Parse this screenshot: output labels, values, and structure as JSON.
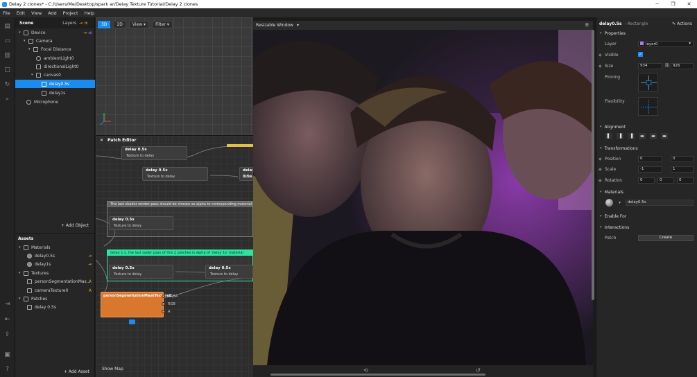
{
  "window": {
    "title": "Delay 2 clones* - C:/Users/Me/Desktop/spark ar/Delay Texture Tutorial/Delay 2 clones",
    "controls": [
      "─",
      "❐",
      "✕"
    ]
  },
  "menu": [
    "File",
    "Edit",
    "View",
    "Add",
    "Project",
    "Help"
  ],
  "scene_panel": {
    "tabs": [
      "Scene",
      "Layers"
    ],
    "items": [
      {
        "label": "Device",
        "icon": "device-icon"
      },
      {
        "label": "Camera",
        "icon": "camera-icon"
      },
      {
        "label": "Focal Distance",
        "icon": "focal-distance-icon"
      },
      {
        "label": "ambientLight0",
        "icon": "ambient-light-icon"
      },
      {
        "label": "directionalLight0",
        "icon": "directional-light-icon"
      },
      {
        "label": "canvas0",
        "icon": "canvas-icon"
      },
      {
        "label": "delay0.5s",
        "icon": "rectangle-icon",
        "selected": true
      },
      {
        "label": "delay1s",
        "icon": "rectangle-icon"
      },
      {
        "label": "Microphone",
        "icon": "microphone-icon"
      }
    ],
    "add_object": "+ Add Object"
  },
  "assets_panel": {
    "title": "Assets",
    "items": [
      {
        "label": "Materials",
        "icon": "folder-icon"
      },
      {
        "label": "delay0.5s",
        "icon": "material-icon"
      },
      {
        "label": "delay1s",
        "icon": "material-icon"
      },
      {
        "label": "Textures",
        "icon": "folder-icon"
      },
      {
        "label": "personSegmentationMas...",
        "icon": "texture-icon",
        "badge": "A"
      },
      {
        "label": "cameraTexture0",
        "icon": "texture-icon",
        "badge": "A"
      },
      {
        "label": "Patches",
        "icon": "folder-icon"
      },
      {
        "label": "delay 0.5s",
        "icon": "patch-icon"
      }
    ],
    "add_asset": "+ Add Asset"
  },
  "viewport_toolbar": {
    "mode_3d": "3D",
    "mode_2d": "2D",
    "view": "View",
    "filter": "Filter"
  },
  "patch_editor": {
    "title": "Patch Editor",
    "group1_label": "The last shader render pass should be chosen as alpha to corresponding material",
    "group2_label": "delay 1 s, the last sader pass of this 2 patches is alpha of 'delay 1s' material",
    "node_title": "delay 0.5s",
    "node_port": "Texture to delay",
    "camera_node": "personSegmentationMaskTexture0",
    "ports": [
      "RGBA",
      "RGB",
      "A"
    ],
    "show_map": "Show Map"
  },
  "preview": {
    "header": "Resizable Window"
  },
  "properties": {
    "object_name": "delay0.5s",
    "object_type": "- Rectangle",
    "actions": "Actions",
    "sections": {
      "properties": "Properties",
      "alignment": "Alignment",
      "transformations": "Transformations",
      "materials": "Materials",
      "enable_for": "Enable For",
      "interactions": "Interactions"
    },
    "layer_label": "Layer",
    "layer_value": "layer0",
    "visible_label": "Visible",
    "size_label": "Size",
    "size_w": "934",
    "size_h": "926",
    "pinning_label": "Pinning",
    "flexibility_label": "Flexibility",
    "position_label": "Position",
    "position": [
      "0",
      "0"
    ],
    "scale_label": "Scale",
    "scale": [
      "-1",
      "1"
    ],
    "rotation_label": "Rotation",
    "rotation": [
      "0",
      "0",
      "0"
    ],
    "material_value": "delay0.5s",
    "patch_label": "Patch",
    "create": "Create"
  },
  "colors": {
    "accent": "#1a8cf0",
    "group_green": "#2de3a0",
    "camera_node": "#d9772e"
  }
}
